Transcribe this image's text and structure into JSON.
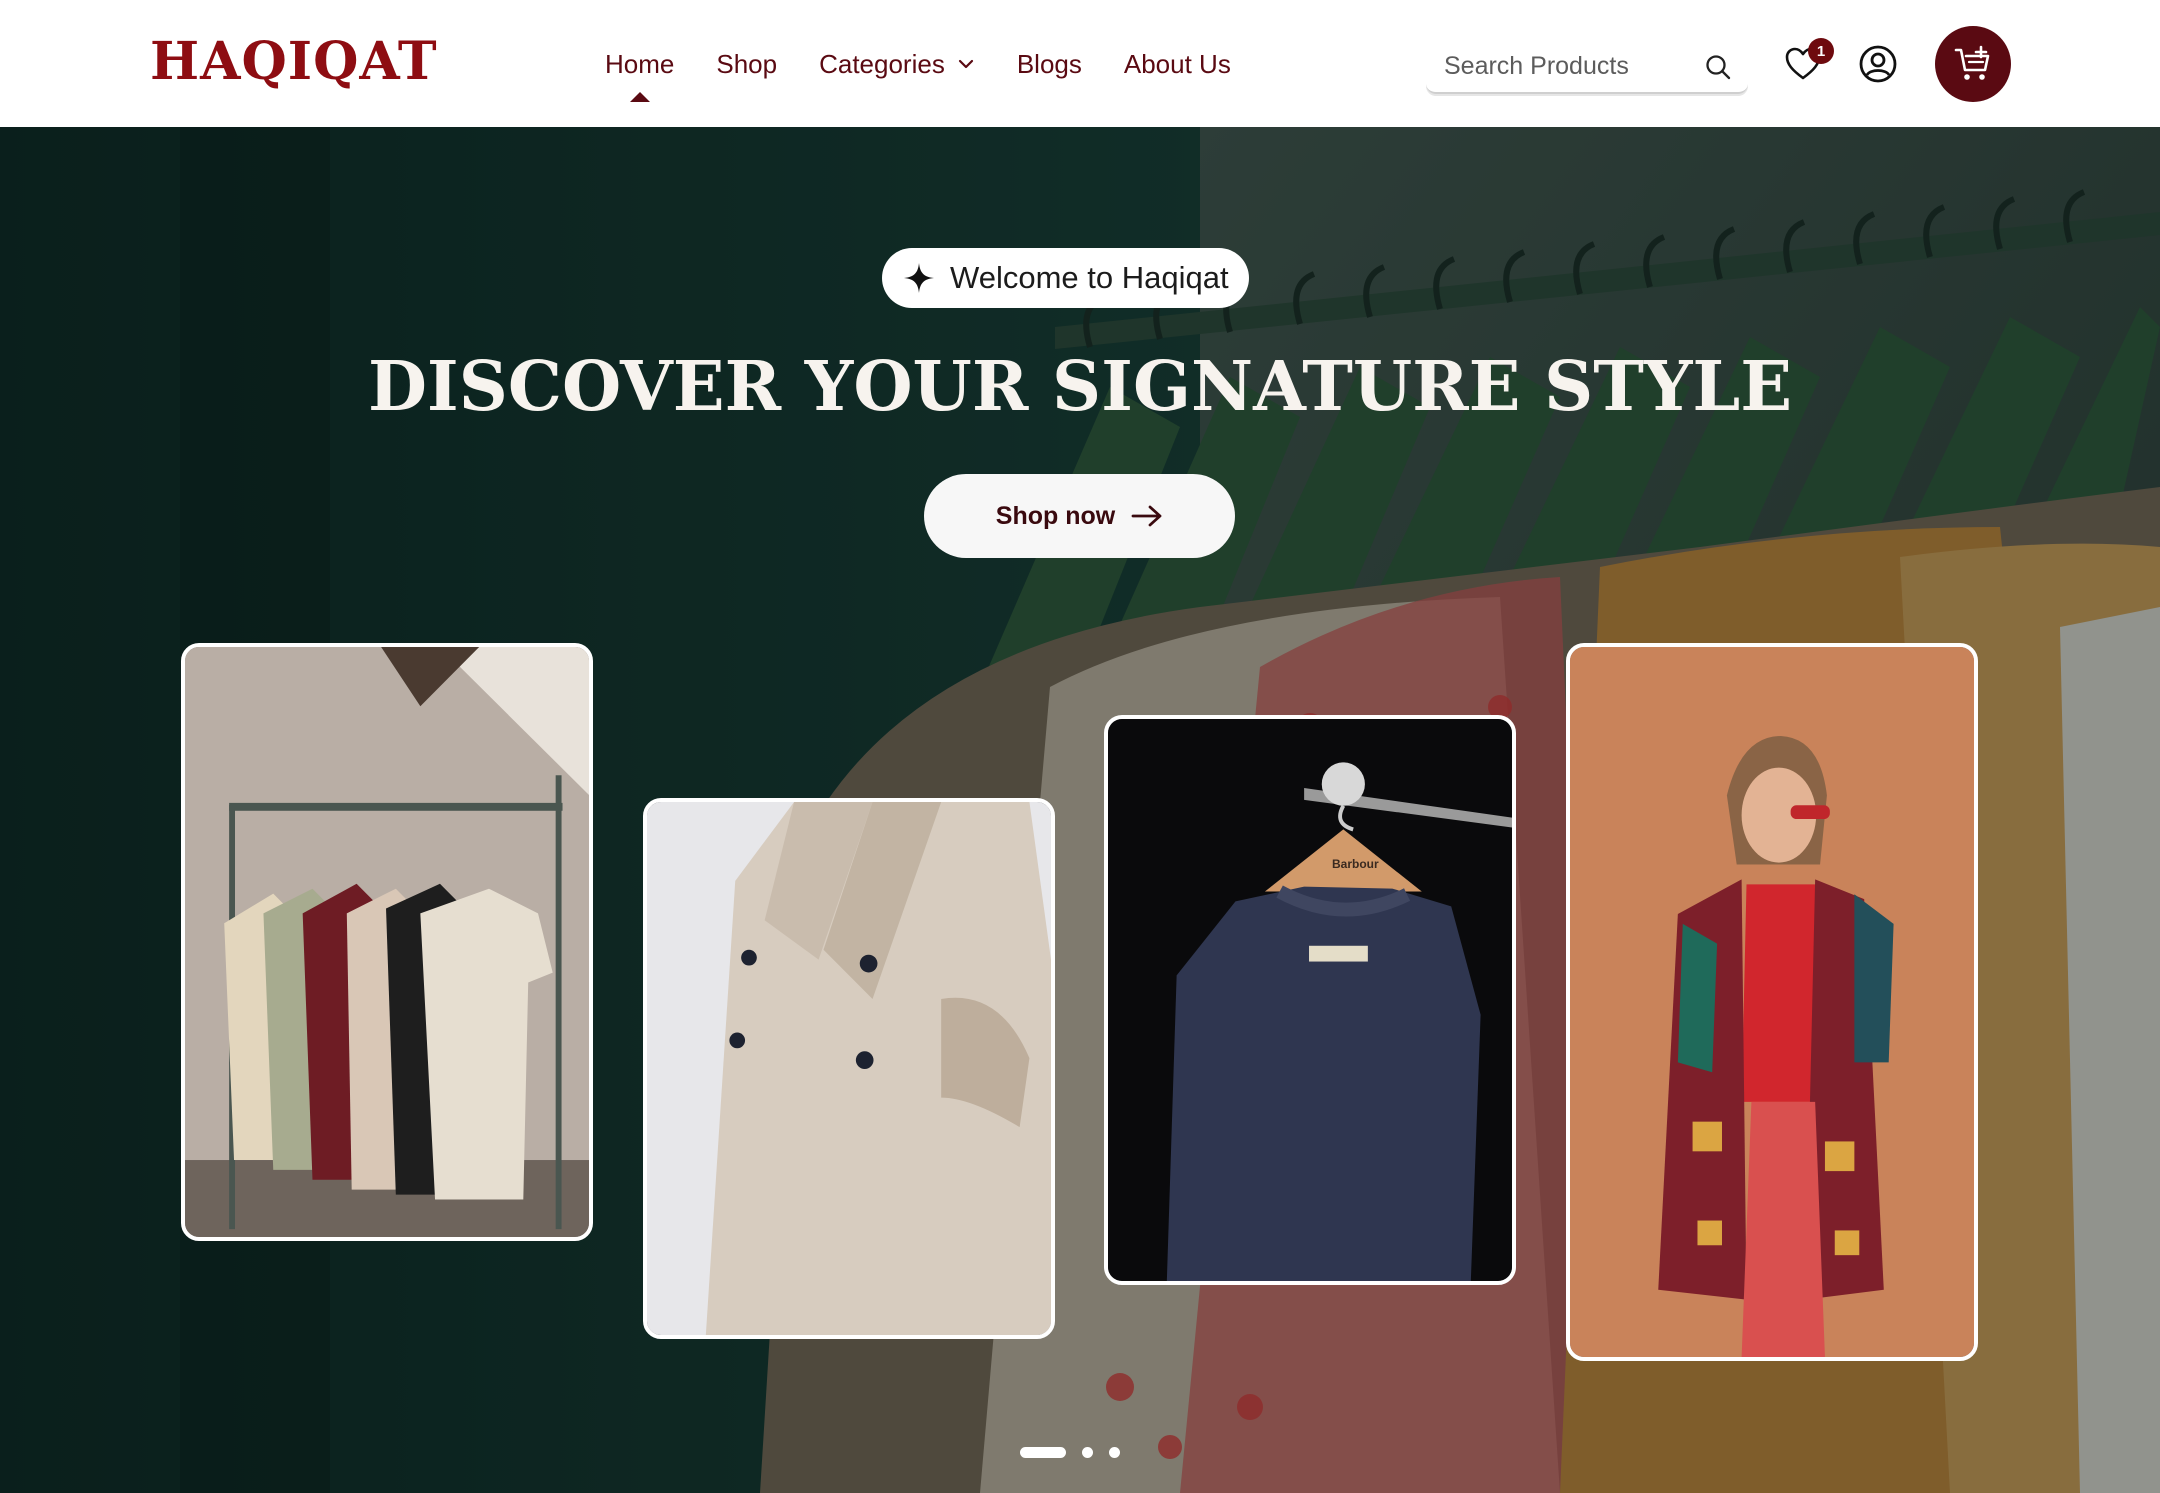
{
  "header": {
    "logo": "HAQIQAT",
    "nav": [
      {
        "label": "Home",
        "active": true
      },
      {
        "label": "Shop",
        "active": false
      },
      {
        "label": "Categories",
        "active": false,
        "has_dropdown": true
      },
      {
        "label": "Blogs",
        "active": false
      },
      {
        "label": "About Us",
        "active": false
      }
    ],
    "search": {
      "placeholder": "Search Products",
      "value": ""
    },
    "wishlist_count": "1",
    "icons": [
      "search-icon",
      "heart-icon",
      "user-icon",
      "cart-add-icon",
      "chevron-down-icon"
    ]
  },
  "hero": {
    "welcome": "Welcome to Haqiqat",
    "title": "DISCOVER YOUR SIGNATURE STYLE",
    "cta": "Shop now",
    "sweater_brand_label": "Barbour",
    "carousel": {
      "slides": 3,
      "active_index": 0
    }
  },
  "colors": {
    "brand": "#8e0d12",
    "primary_dark": "#5a0a12",
    "nav_text": "#5a0a12",
    "hero_text": "#f7f3ee",
    "white": "#ffffff"
  }
}
